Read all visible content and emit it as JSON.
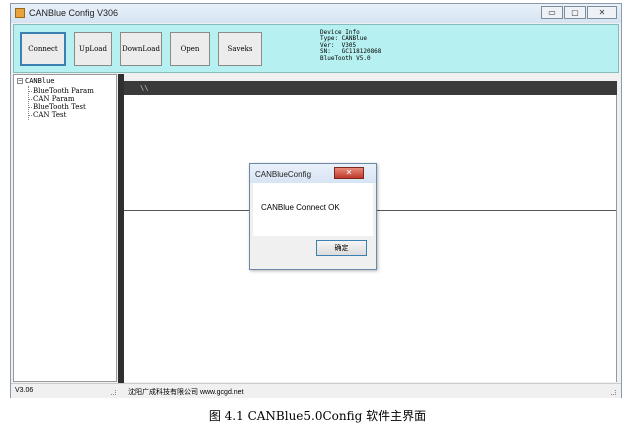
{
  "window": {
    "title": "CANBlue Config V306",
    "buttons": {
      "minimize": "▭",
      "maximize": "▢",
      "close": "✕"
    }
  },
  "toolbar": {
    "buttons": [
      "Connect",
      "UpLoad",
      "DownLoad",
      "Open",
      "Saveks"
    ]
  },
  "device_info": {
    "text": "Device Info\nType: CANBlue\nVer:  V305\nSN:   GC118120868\nBlueTooth V5.0"
  },
  "tree": {
    "root": "CANBlue",
    "items": [
      "BlueTooth Param",
      "CAN Param",
      "BlueTooth Test",
      "CAN Test"
    ]
  },
  "canvas": {
    "header_label": "\\\\"
  },
  "dialog": {
    "title": "CANBlueConfig",
    "close": "✕",
    "message": "CANBlue Connect OK",
    "ok_label": "确定"
  },
  "status": {
    "version": "V3.06",
    "company": "沈阳广成科技有限公司   www.gcgd.net"
  },
  "caption": "图 4.1 CANBlue5.0Config 软件主界面",
  "colors": {
    "toolbar_bg": "#b7f0f0",
    "canvas_header": "#3a3a3a",
    "accent": "#3c7fb1"
  }
}
